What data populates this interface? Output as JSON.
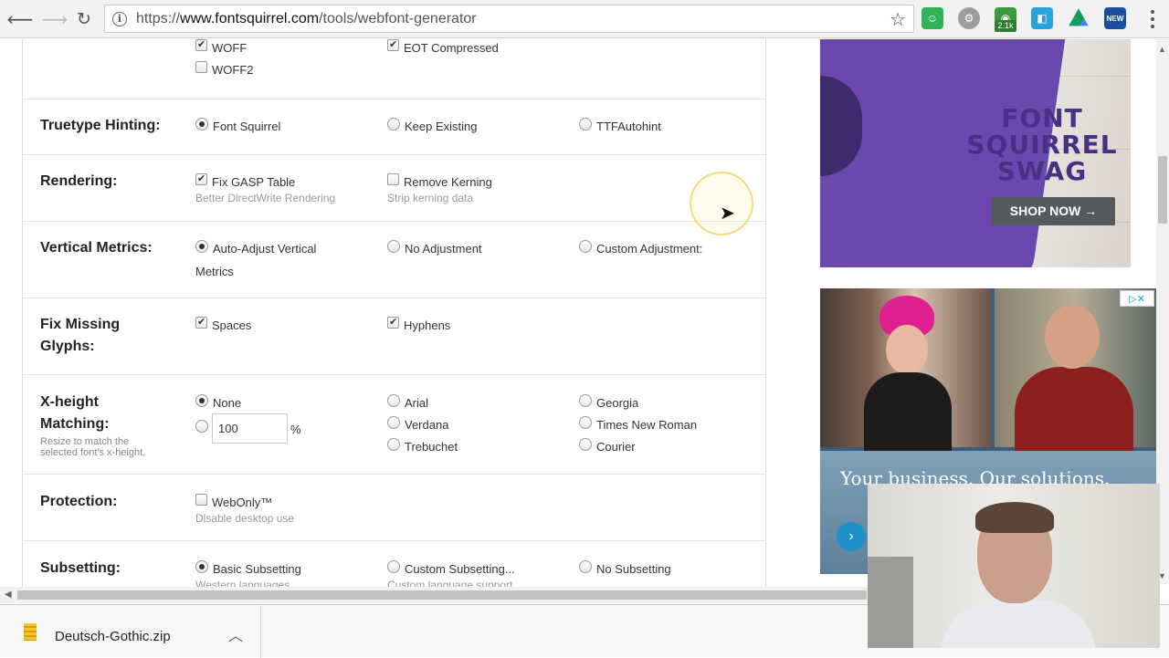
{
  "browser": {
    "url_scheme": "https://",
    "url_host": "www.fontsquirrel.com",
    "url_path": "/tools/webfont-generator",
    "ext_badge": "2.1k",
    "ext_new": "NEW"
  },
  "formats": {
    "woff": {
      "label": "WOFF",
      "checked": true
    },
    "woff2": {
      "label": "WOFF2",
      "checked": false
    },
    "eot": {
      "label": "EOT Compressed",
      "checked": true
    }
  },
  "hinting": {
    "label": "Truetype Hinting:",
    "options": [
      "Font Squirrel",
      "Keep Existing",
      "TTFAutohint"
    ],
    "selected": "Font Squirrel"
  },
  "rendering": {
    "label": "Rendering:",
    "fix_gasp": {
      "label": "Fix GASP Table",
      "sub": "Better DirectWrite Rendering",
      "checked": true
    },
    "remove_kerning": {
      "label": "Remove Kerning",
      "sub": "Strip kerning data",
      "checked": false
    }
  },
  "vertical": {
    "label": "Vertical Metrics:",
    "auto_line1": "Auto-Adjust Vertical",
    "auto_line2": "Metrics",
    "no_adjust": "No Adjustment",
    "custom": "Custom Adjustment:",
    "selected": "Auto-Adjust Vertical Metrics"
  },
  "missing": {
    "label_line1": "Fix Missing",
    "label_line2": "Glyphs:",
    "spaces": {
      "label": "Spaces",
      "checked": true
    },
    "hyphens": {
      "label": "Hyphens",
      "checked": true
    }
  },
  "xheight": {
    "label_line1": "X-height",
    "label_line2": "Matching:",
    "hint_line1": "Resize to match the",
    "hint_line2": "selected font's x-height.",
    "none": "None",
    "value": "100",
    "unit": "%",
    "fonts": [
      "Arial",
      "Verdana",
      "Trebuchet",
      "Georgia",
      "Times New Roman",
      "Courier"
    ],
    "selected": "None"
  },
  "protection": {
    "label": "Protection:",
    "webonly": {
      "label": "WebOnly™",
      "sub": "Disable desktop use",
      "checked": false
    }
  },
  "subsetting": {
    "label": "Subsetting:",
    "options": [
      "Basic Subsetting",
      "Custom Subsetting...",
      "No Subsetting"
    ],
    "subs": [
      "Western languages",
      "Custom language support"
    ],
    "selected": "Basic Subsetting"
  },
  "ads": {
    "swag_line1": "FONT",
    "swag_line2": "SQUIRREL",
    "swag_line3": "SWAG",
    "shop_button": "SHOP NOW →",
    "tagline": "Your business. Our solutions."
  },
  "download": {
    "filename": "Deutsch-Gothic.zip"
  }
}
